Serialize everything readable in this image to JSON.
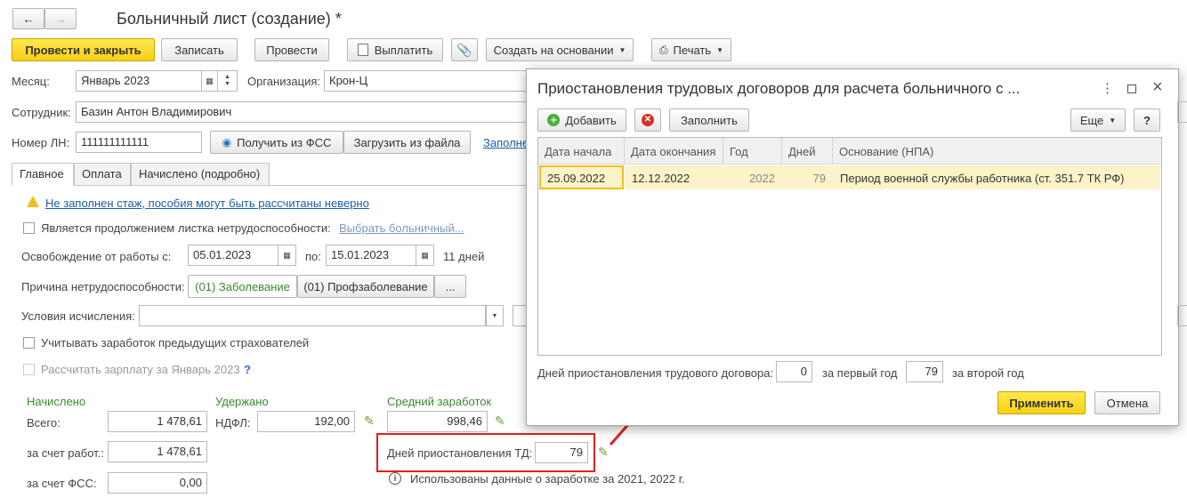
{
  "window": {
    "title": "Больничный лист (создание) *"
  },
  "toolbar": {
    "post_close": "Провести и закрыть",
    "save": "Записать",
    "post": "Провести",
    "pay": "Выплатить",
    "create_based": "Создать на основании",
    "print": "Печать"
  },
  "form": {
    "month_label": "Месяц:",
    "month_value": "Январь 2023",
    "org_label": "Организация:",
    "org_value": "Крон-Ц",
    "employee_label": "Сотрудник:",
    "employee_value": "Базин Антон Владимирович",
    "ln_label": "Номер ЛН:",
    "ln_value": "111111111111",
    "get_fss": "Получить из ФСС",
    "load_file": "Загрузить из файла",
    "fill_link": "Заполне"
  },
  "tabs": [
    "Главное",
    "Оплата",
    "Начислено (подробно)"
  ],
  "main": {
    "warning_link": "Не заполнен стаж, пособия могут быть рассчитаны неверно",
    "continuation_label": "Является продолжением листка нетрудоспособности:",
    "choose_sick": "Выбрать больничный...",
    "release_label": "Освобождение от работы с:",
    "release_from": "05.01.2023",
    "release_to_label": "по:",
    "release_to": "15.01.2023",
    "days_text": "11 дней",
    "reason_label": "Причина нетрудоспособности:",
    "reason_selected": "(01) Заболевание",
    "reason_other": "(01) Профзаболевание",
    "reason_more": "...",
    "calc_label": "Условия исчисления:",
    "prev_insurers": "Учитывать заработок предыдущих страхователей",
    "calc_salary": "Рассчитать зарплату за Январь 2023",
    "help_q": "?"
  },
  "totals": {
    "accrued_title": "Начислено",
    "total_label": "Всего:",
    "total_value": "1 478,61",
    "employer_label": "за счет работ.:",
    "employer_value": "1 478,61",
    "fss_label": "за счет ФСС:",
    "fss_value": "0,00",
    "withheld_title": "Удержано",
    "ndfl_label": "НДФЛ:",
    "ndfl_value": "192,00",
    "avg_title": "Средний заработок",
    "avg_value": "998,46",
    "susp_label": "Дней приостановления ТД:",
    "susp_value": "79",
    "info_text": "Использованы данные о заработке за  2021,  2022 г."
  },
  "dialog": {
    "title": "Приостановления трудовых договоров для расчета больничного с ...",
    "add": "Добавить",
    "fill": "Заполнить",
    "more": "Еще",
    "help": "?",
    "columns": [
      "Дата начала",
      "Дата окончания",
      "Год",
      "Дней",
      "Основание (НПА)"
    ],
    "rows": [
      {
        "start": "25.09.2022",
        "end": "12.12.2022",
        "year": "2022",
        "days": "79",
        "basis": "Период военной службы работника (ст. 351.7 ТК РФ)"
      }
    ],
    "footer_label": "Дней приостановления трудового договора:",
    "first_year_value": "0",
    "first_year_label": "за первый год",
    "second_year_value": "79",
    "second_year_label": "за второй год",
    "apply": "Применить",
    "cancel": "Отмена"
  },
  "colors": {
    "accent_yellow": "#f5cf14",
    "green_text": "#3a8a2e",
    "highlight_red": "#e02020",
    "link_blue": "#1a5ea8"
  }
}
